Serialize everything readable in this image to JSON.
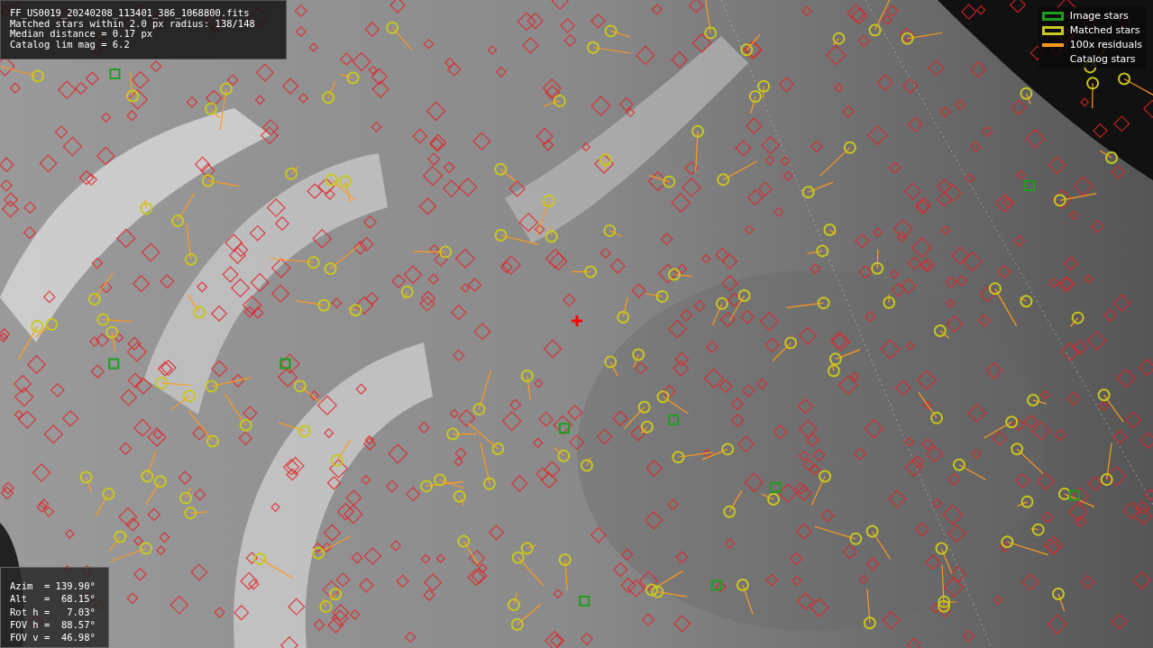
{
  "info_box": {
    "lines": [
      "FF_US0019_20240208_113401_386_1068800.fits",
      "Matched stars within 2.0 px radius: 138/148",
      "Median distance = 0.17 px",
      "Catalog lim mag = 6.2"
    ]
  },
  "legend": [
    {
      "kind": "box",
      "color": "#1e9e1e",
      "label": "Image stars"
    },
    {
      "kind": "box",
      "color": "#c8c81e",
      "label": "Matched stars"
    },
    {
      "kind": "line",
      "color": "#ff9a1e",
      "label": "100x residuals"
    },
    {
      "kind": "none",
      "label": "Catalog stars"
    }
  ],
  "pointing_box": {
    "lines": [
      "Azim  = 139.90°",
      "Alt   =  68.15°",
      "Rot h =   7.03°",
      "FOV h =  88.57°",
      "FOV v =  46.98°"
    ]
  }
}
